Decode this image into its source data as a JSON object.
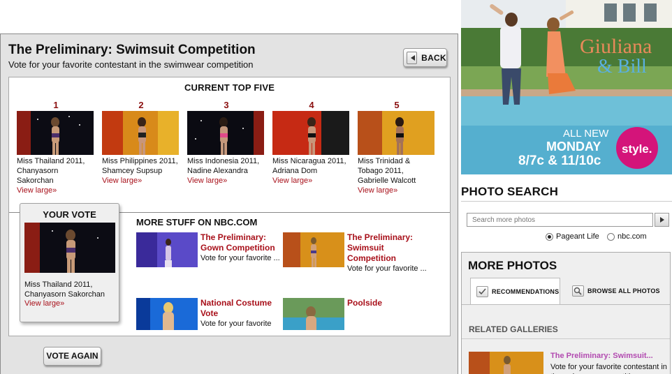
{
  "panel": {
    "title": "The Preliminary: Swimsuit Competition",
    "subtitle": "Vote for your favorite contestant in the swimwear competition",
    "back_label": "BACK",
    "top_five_title": "CURRENT TOP FIVE",
    "contestants": [
      {
        "rank": "1",
        "name": "Miss Thailand 2011, Chanyasorn Sakorchan",
        "link": "View large»"
      },
      {
        "rank": "2",
        "name": "Miss Philippines 2011, Shamcey Supsup",
        "link": "View large»"
      },
      {
        "rank": "3",
        "name": "Miss Indonesia 2011, Nadine Alexandra",
        "link": "View large»"
      },
      {
        "rank": "4",
        "name": "Miss Nicaragua 2011, Adriana Dom",
        "link": "View large»"
      },
      {
        "rank": "5",
        "name": "Miss Trinidad & Tobago 2011, Gabrielle Walcott",
        "link": "View large»"
      }
    ],
    "your_vote": {
      "title": "YOUR VOTE",
      "name": "Miss Thailand 2011, Chanyasorn Sakorchan",
      "link": "View large»"
    },
    "more_stuff": {
      "title": "MORE STUFF ON NBC.COM",
      "items": [
        {
          "title": "The Preliminary: Gown Competition",
          "desc": "Vote for your favorite ..."
        },
        {
          "title": "The Preliminary: Swimsuit Competition",
          "desc": "Vote for your favorite ..."
        },
        {
          "title": "National Costume Vote",
          "desc": "Vote for your favorite"
        },
        {
          "title": "Poolside",
          "desc": ""
        }
      ]
    },
    "vote_again_label": "VOTE AGAIN"
  },
  "ad": {
    "show_title_1": "Giuliana",
    "show_title_2": "& Bill",
    "line1": "ALL NEW",
    "line2": "MONDAY",
    "line3": "8/7c & 11/10c",
    "network": "style."
  },
  "photo_search": {
    "title": "PHOTO SEARCH",
    "placeholder": "Search more photos",
    "option1": "Pageant Life",
    "option2": "nbc.com",
    "selected": "Pageant Life"
  },
  "more_photos": {
    "title": "MORE PHOTOS",
    "tab1": "RECOMMENDATIONS",
    "tab2": "BROWSE ALL PHOTOS",
    "related_title": "RELATED GALLERIES",
    "gallery_title": "The Preliminary: Swimsuit...",
    "gallery_desc": "Vote for your favorite contestant in the swimwear competition"
  },
  "colors": {
    "accent_red": "#a8101a",
    "rank_red": "#8b1010",
    "gallery_pink": "#b24ab0",
    "style_magenta": "#d4147a"
  }
}
